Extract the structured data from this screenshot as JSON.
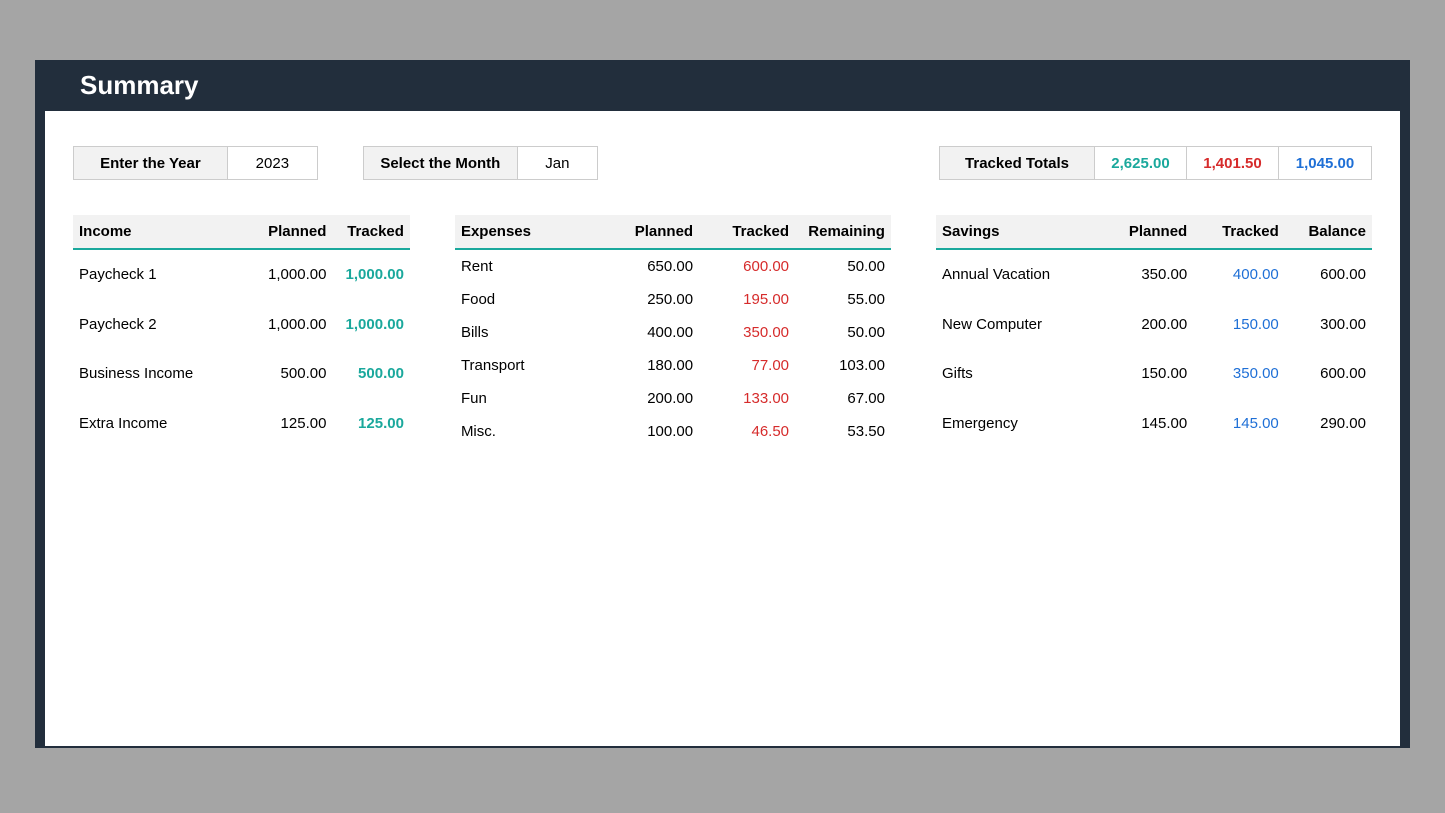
{
  "title": "Summary",
  "yearControl": {
    "label": "Enter the Year",
    "value": "2023"
  },
  "monthControl": {
    "label": "Select the Month",
    "value": "Jan"
  },
  "totals": {
    "label": "Tracked Totals",
    "income": "2,625.00",
    "expenses": "1,401.50",
    "savings": "1,045.00"
  },
  "income": {
    "header": {
      "name": "Income",
      "planned": "Planned",
      "tracked": "Tracked"
    },
    "rows": [
      {
        "name": "Paycheck 1",
        "planned": "1,000.00",
        "tracked": "1,000.00"
      },
      {
        "name": "Paycheck 2",
        "planned": "1,000.00",
        "tracked": "1,000.00"
      },
      {
        "name": "Business Income",
        "planned": "500.00",
        "tracked": "500.00"
      },
      {
        "name": "Extra Income",
        "planned": "125.00",
        "tracked": "125.00"
      }
    ]
  },
  "expenses": {
    "header": {
      "name": "Expenses",
      "planned": "Planned",
      "tracked": "Tracked",
      "remaining": "Remaining"
    },
    "rows": [
      {
        "name": "Rent",
        "planned": "650.00",
        "tracked": "600.00",
        "remaining": "50.00"
      },
      {
        "name": "Food",
        "planned": "250.00",
        "tracked": "195.00",
        "remaining": "55.00"
      },
      {
        "name": "Bills",
        "planned": "400.00",
        "tracked": "350.00",
        "remaining": "50.00"
      },
      {
        "name": "Transport",
        "planned": "180.00",
        "tracked": "77.00",
        "remaining": "103.00"
      },
      {
        "name": "Fun",
        "planned": "200.00",
        "tracked": "133.00",
        "remaining": "67.00"
      },
      {
        "name": "Misc.",
        "planned": "100.00",
        "tracked": "46.50",
        "remaining": "53.50"
      }
    ]
  },
  "savings": {
    "header": {
      "name": "Savings",
      "planned": "Planned",
      "tracked": "Tracked",
      "balance": "Balance"
    },
    "rows": [
      {
        "name": "Annual Vacation",
        "planned": "350.00",
        "tracked": "400.00",
        "balance": "600.00"
      },
      {
        "name": "New Computer",
        "planned": "200.00",
        "tracked": "150.00",
        "balance": "300.00"
      },
      {
        "name": "Gifts",
        "planned": "150.00",
        "tracked": "350.00",
        "balance": "600.00"
      },
      {
        "name": "Emergency",
        "planned": "145.00",
        "tracked": "145.00",
        "balance": "290.00"
      }
    ]
  }
}
